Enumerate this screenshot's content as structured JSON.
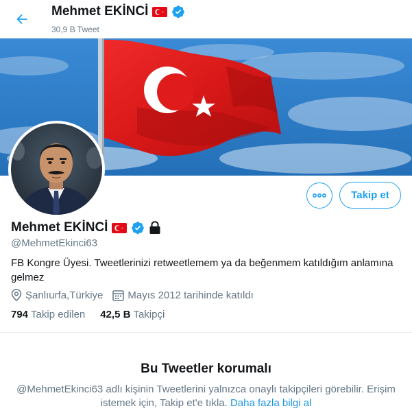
{
  "header": {
    "name": "Mehmet EKİNCİ",
    "tweet_count": "30,9 B Tweet"
  },
  "profile": {
    "name": "Mehmet EKİNCİ",
    "handle": "@MehmetEkinci63",
    "bio": "FB Kongre Üyesi. Tweetlerinizi retweetlemem ya da beğenmem katıldığım anlamına gelmez",
    "location": "Şanlıurfa,Türkiye",
    "joined": "Mayıs 2012 tarihinde katıldı"
  },
  "actions": {
    "follow_label": "Takip et"
  },
  "stats": {
    "following_count": "794",
    "following_label": "Takip edilen",
    "followers_count": "42,5 B",
    "followers_label": "Takipçi"
  },
  "protected": {
    "title": "Bu Tweetler korumalı",
    "description": "@MehmetEkinci63 adlı kişinin Tweetlerini yalnızca onaylı takipçileri görebilir. Erişim istemek için, Takip et'e tıkla.",
    "learn_more": "Daha fazla bilgi al"
  },
  "colors": {
    "accent": "#1da1f2",
    "flag_red": "#e30a17",
    "sky_blue": "#2d7fc7"
  },
  "icons": [
    "back-arrow-icon",
    "turkish-flag-icon",
    "verified-badge-icon",
    "lock-icon",
    "more-icon",
    "location-icon",
    "calendar-icon"
  ]
}
